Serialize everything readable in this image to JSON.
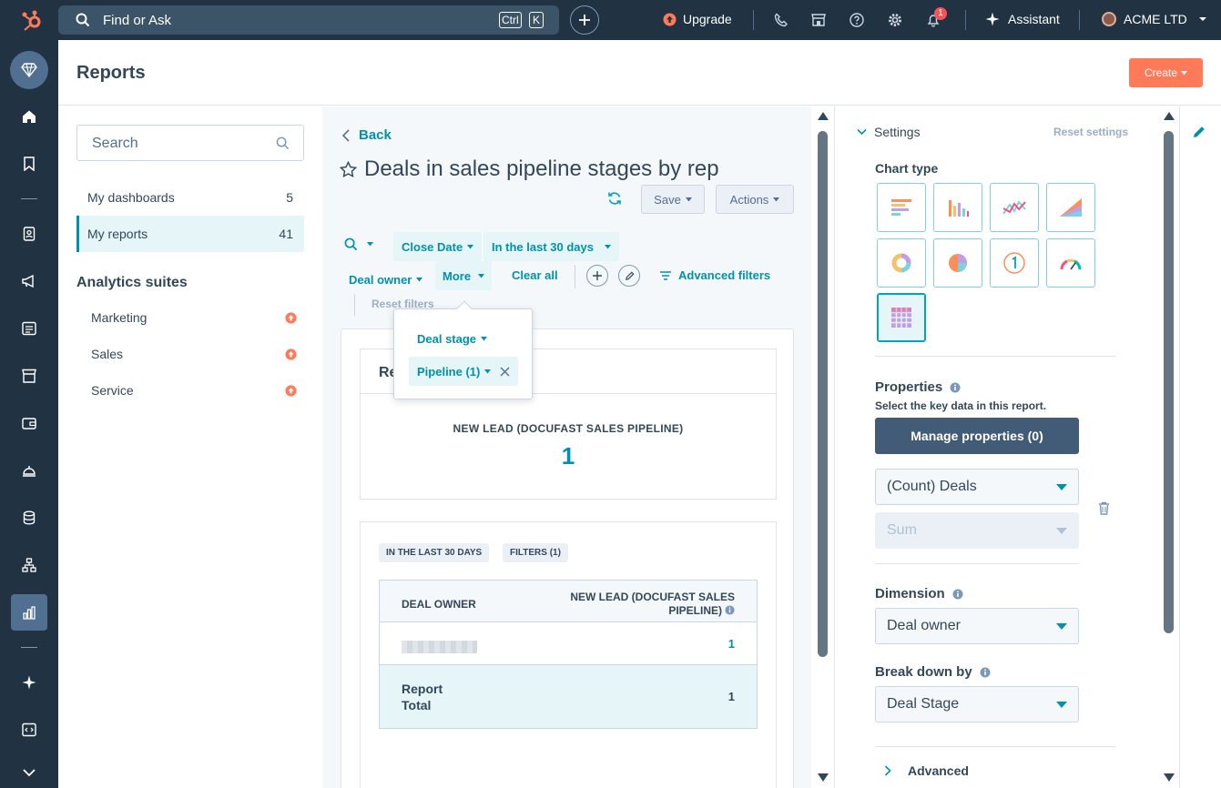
{
  "topbar": {
    "search_placeholder": "Find or Ask",
    "kbd_ctrl": "Ctrl",
    "kbd_k": "K",
    "upgrade": "Upgrade",
    "notif_count": "1",
    "assistant": "Assistant",
    "account": "ACME LTD"
  },
  "header": {
    "title": "Reports",
    "create": "Create"
  },
  "left": {
    "search_placeholder": "Search",
    "items": [
      {
        "label": "My dashboards",
        "count": "5"
      },
      {
        "label": "My reports",
        "count": "41"
      }
    ],
    "suites_title": "Analytics suites",
    "suites": [
      "Marketing",
      "Sales",
      "Service"
    ]
  },
  "center": {
    "back": "Back",
    "title": "Deals in sales pipeline stages by rep",
    "save": "Save",
    "actions": "Actions",
    "filters": {
      "close_date": "Close Date",
      "range": "In the last 30 days",
      "deal_owner": "Deal owner",
      "more": "More",
      "clear_all": "Clear all",
      "advanced": "Advanced filters",
      "reset": "Reset filters"
    },
    "dropdown": {
      "deal_stage": "Deal stage",
      "pipeline": "Pipeline (1)"
    },
    "card_title_partial": "Re",
    "kpi": {
      "label": "NEW LEAD (DOCUFAST SALES PIPELINE)",
      "value": "1"
    },
    "tags": [
      "IN THE LAST 30 DAYS",
      "FILTERS (1)"
    ],
    "table": {
      "col1": "DEAL OWNER",
      "col2a": "NEW LEAD (DOCUFAST SALES",
      "col2b": "PIPELINE)",
      "row_value": "1",
      "total_label_a": "Report",
      "total_label_b": "Total",
      "total_value": "1"
    }
  },
  "right": {
    "settings": "Settings",
    "reset_settings": "Reset settings",
    "chart_type": "Chart type",
    "properties": "Properties",
    "properties_help": "Select the key data in this report.",
    "manage": "Manage properties (0)",
    "count_select": "(Count) Deals",
    "sum_select": "Sum",
    "dimension": "Dimension",
    "dimension_value": "Deal owner",
    "breakdown": "Break down by",
    "breakdown_value": "Deal Stage",
    "advanced": "Advanced"
  },
  "colors": {
    "nav": "#213343",
    "accent": "#0091ae",
    "create": "#ff7a59",
    "primary_dark": "#425b76"
  }
}
